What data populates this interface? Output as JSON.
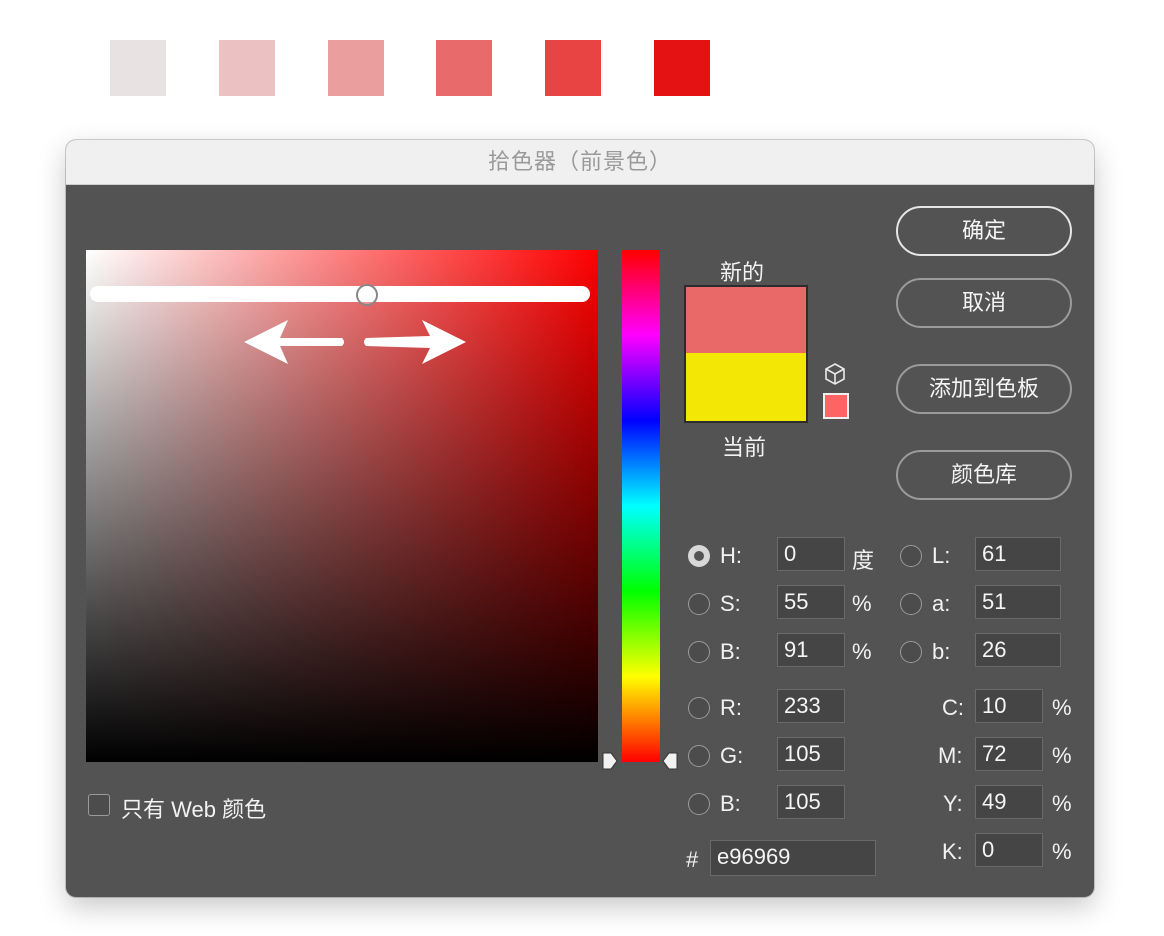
{
  "swatches": [
    "#e8e2e2",
    "#ecc1c1",
    "#eb9e9e",
    "#e96a6a",
    "#e94444",
    "#e41212"
  ],
  "dialog": {
    "title": "拾色器（前景色）",
    "labels": {
      "new": "新的",
      "current": "当前"
    },
    "colors": {
      "new": "#e96969",
      "current": "#f3e706"
    },
    "buttons": {
      "ok": "确定",
      "cancel": "取消",
      "add_to_swatches": "添加到色板",
      "color_libraries": "颜色库"
    },
    "web_only_label": "只有 Web 颜色",
    "hsb": {
      "h_label": "H:",
      "h_value": "0",
      "h_unit": "度",
      "s_label": "S:",
      "s_value": "55",
      "s_unit": "%",
      "b_label": "B:",
      "b_value": "91",
      "b_unit": "%",
      "selected": "H"
    },
    "lab": {
      "l_label": "L:",
      "l_value": "61",
      "a_label": "a:",
      "a_value": "51",
      "b_label": "b:",
      "b_value": "26"
    },
    "rgb": {
      "r_label": "R:",
      "r_value": "233",
      "g_label": "G:",
      "g_value": "105",
      "b_label": "B:",
      "b_value": "105"
    },
    "cmyk": {
      "c_label": "C:",
      "c_value": "10",
      "m_label": "M:",
      "m_value": "72",
      "y_label": "Y:",
      "y_value": "49",
      "k_label": "K:",
      "k_value": "0",
      "unit": "%"
    },
    "hex_label": "#",
    "hex_value": "e96969",
    "icons": [
      "cube-icon",
      "web-safe-swatch-icon",
      "double-arrow-icon"
    ]
  }
}
